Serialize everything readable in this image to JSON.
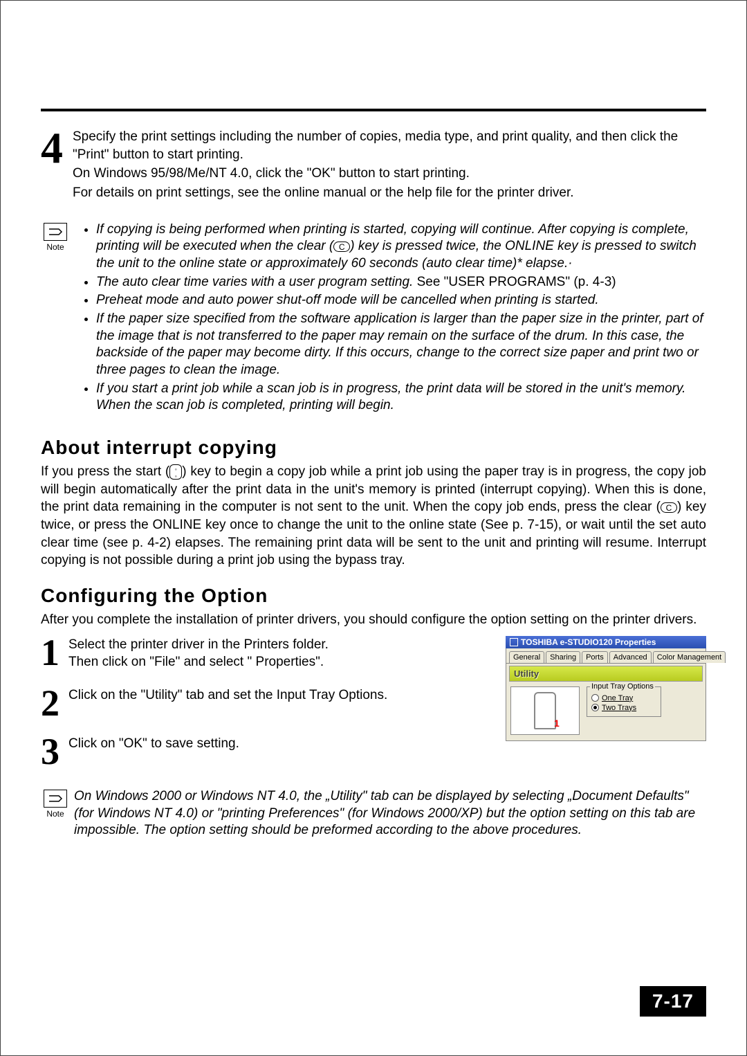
{
  "step4": {
    "num": "4",
    "main": "Specify the print settings including the number of copies, media type, and print quality, and then click the \"Print\" button to start printing.",
    "sub1": "On Windows 95/98/Me/NT 4.0, click the \"OK\" button to start printing.",
    "sub2": "For details on print settings, see the online manual or the help file for the printer driver."
  },
  "note_label": "Note",
  "note1": {
    "b1a": "If copying is being performed when printing is started, copying will continue. After copying is complete, printing will be executed when the clear (",
    "b1b": ") key is pressed twice, the ONLINE key is pressed to switch the unit to the online state or approximately 60 seconds (auto clear time)* elapse.·",
    "b2a": "The auto clear time varies with a user program setting. ",
    "b2b": "See \"USER PROGRAMS\" (p. 4-3)",
    "b3": "Preheat mode and auto power shut-off mode will be cancelled when printing is started.",
    "b4": "If the paper size specified from the software application is larger than the paper size in the printer, part of the image that is not transferred to the paper may remain on the surface of the drum. In this case, the backside of the paper may become dirty. If this occurs, change to the correct size paper and print two or three pages to clean the image.",
    "b5": "If you start a print job while a scan job is in progress, the print data will be stored in the unit's memory. When the scan job is completed, printing will begin."
  },
  "interrupt": {
    "heading": "About interrupt copying",
    "p1a": "If you press the start (",
    "p1b": ") key to begin a copy job while a print job using the paper tray is in progress, the copy job will begin automatically after the print data in the unit's memory is printed (interrupt copying). When this is done, the print data remaining in the computer is not sent to the unit. When the copy job ends, press the clear (",
    "p1c": ") key twice, or press the ONLINE key once to change the unit to the online state (See p. 7-15), or wait until the set auto clear time (see p. 4-2) elapses. The remaining print data will be sent to the unit and printing will resume. Interrupt copying is not possible during a print job using the bypass tray."
  },
  "config": {
    "heading": "Configuring the Option",
    "intro": "After you complete the installation of printer drivers, you should configure the option setting on the printer drivers.",
    "s1n": "1",
    "s1a": "Select the printer driver in the Printers folder.",
    "s1b": "Then click on \"File\" and select \" Properties\".",
    "s2n": "2",
    "s2": "Click on the \"Utility\" tab and set the Input Tray Options.",
    "s3n": "3",
    "s3": "Click on \"OK\" to save setting."
  },
  "dialog": {
    "title": "TOSHIBA e-STUDIO120 Properties",
    "tabs": {
      "general": "General",
      "sharing": "Sharing",
      "ports": "Ports",
      "advanced": "Advanced",
      "color": "Color Management"
    },
    "utility": "Utility",
    "red1": "1",
    "group": "Input Tray Options",
    "opt1": "One Tray",
    "opt2": "Two Trays"
  },
  "note2": "On Windows 2000 or Windows NT 4.0, the „Utility\" tab can be displayed by selecting „Document Defaults\" (for Windows NT 4.0) or \"printing Preferences\" (for Windows 2000/XP) but the option setting on this tab are impossible. The option setting should be preformed according to the above procedures.",
  "clear_key": "C",
  "page_number": "7-17"
}
